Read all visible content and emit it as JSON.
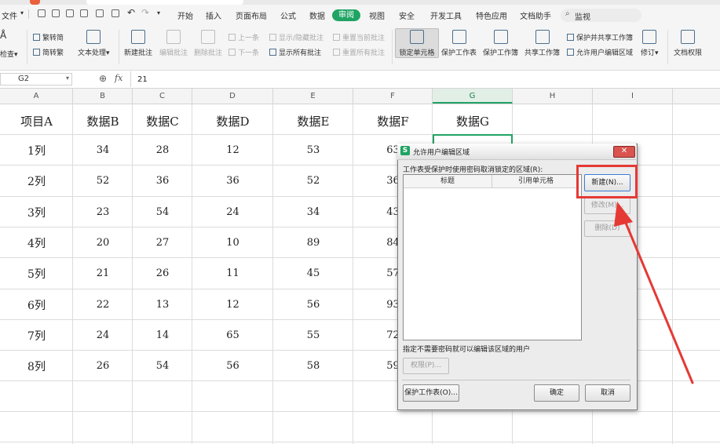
{
  "menubar": {
    "file_label": "文件",
    "tabs": [
      "开始",
      "插入",
      "页面布局",
      "公式",
      "数据",
      "审阅",
      "视图",
      "安全",
      "开发工具",
      "特色应用",
      "文档助手"
    ],
    "active_tab": "审阅",
    "search_placeholder": "监视"
  },
  "ribbon": {
    "spell_check": "检查",
    "trad_to_simp": "繁转简",
    "simp_to_trad": "简转繁",
    "text_process": "文本处理",
    "new_comment": "新建批注",
    "edit_comment": "编辑批注",
    "delete_comment": "删除批注",
    "prev_comment": "上一条",
    "next_comment": "下一条",
    "show_hide_comment": "显示/隐藏批注",
    "show_all_comments": "显示所有批注",
    "reset_current_comment": "重置当前批注",
    "reset_all_comments": "重置所有批注",
    "lock_cell": "锁定单元格",
    "protect_sheet": "保护工作表",
    "protect_workbook": "保护工作簿",
    "share_workbook": "共享工作簿",
    "protect_share_workbook": "保护并共享工作簿",
    "allow_edit_ranges": "允许用户编辑区域",
    "revisions": "修订",
    "doc_permissions": "文档权限"
  },
  "formula_bar": {
    "name_box": "G2",
    "fx_label": "fx",
    "value": "21"
  },
  "sheet": {
    "columns": [
      "A",
      "B",
      "C",
      "D",
      "E",
      "F",
      "G",
      "H",
      "I"
    ],
    "selected_column": "G",
    "header_row": [
      "项目A",
      "数据B",
      "数据C",
      "数据D",
      "数据E",
      "数据F",
      "数据G"
    ],
    "rows": [
      [
        "1列",
        "34",
        "28",
        "12",
        "53",
        "63"
      ],
      [
        "2列",
        "52",
        "36",
        "36",
        "52",
        "36"
      ],
      [
        "3列",
        "23",
        "54",
        "24",
        "34",
        "43"
      ],
      [
        "4列",
        "20",
        "27",
        "10",
        "89",
        "84"
      ],
      [
        "5列",
        "21",
        "26",
        "11",
        "45",
        "57"
      ],
      [
        "6列",
        "22",
        "13",
        "12",
        "56",
        "93"
      ],
      [
        "7列",
        "24",
        "14",
        "65",
        "55",
        "72"
      ],
      [
        "8列",
        "26",
        "54",
        "56",
        "58",
        "59"
      ]
    ]
  },
  "dialog": {
    "title": "允许用户编辑区域",
    "ranges_caption": "工作表受保护时使用密码取消锁定的区域(R):",
    "col_title": "标题",
    "col_ref": "引用单元格",
    "new_button": "新建(N)...",
    "modify_button": "修改(M)...",
    "delete_button": "删除(D)",
    "permission_caption": "指定不需要密码就可以编辑该区域的用户",
    "permission_button": "权限(P)...",
    "protect_sheet_button": "保护工作表(O)...",
    "ok_button": "确定",
    "cancel_button": "取消",
    "close_glyph": "✕"
  },
  "colors": {
    "accent_green": "#1fa463",
    "highlight_red": "#e53935"
  }
}
